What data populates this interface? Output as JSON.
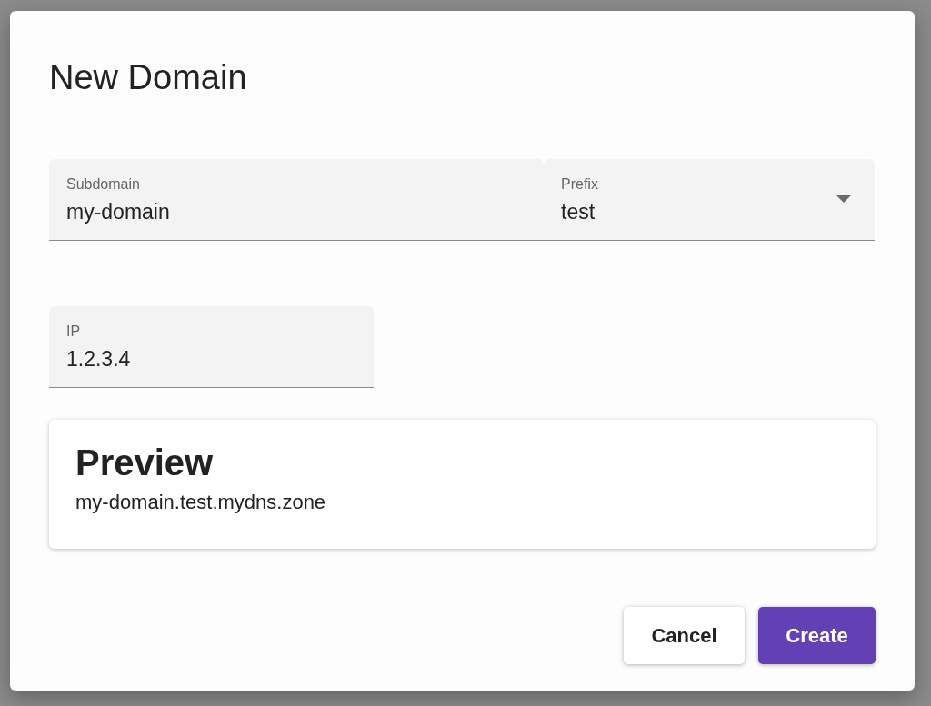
{
  "dialog": {
    "title": "New Domain",
    "field_rows": [
      {
        "fields": [
          {
            "kind": "text",
            "label": "Subdomain",
            "value": "my-domain"
          },
          {
            "kind": "select",
            "label": "Prefix",
            "value": "test"
          }
        ]
      },
      {
        "fields": [
          {
            "kind": "text",
            "label": "IP",
            "value": "1.2.3.4"
          }
        ]
      }
    ],
    "preview": {
      "heading": "Preview",
      "text": "my-domain.test.mydns.zone"
    },
    "buttons": [
      {
        "label": "Cancel",
        "kind": "secondary"
      },
      {
        "label": "Create",
        "kind": "primary"
      }
    ]
  }
}
